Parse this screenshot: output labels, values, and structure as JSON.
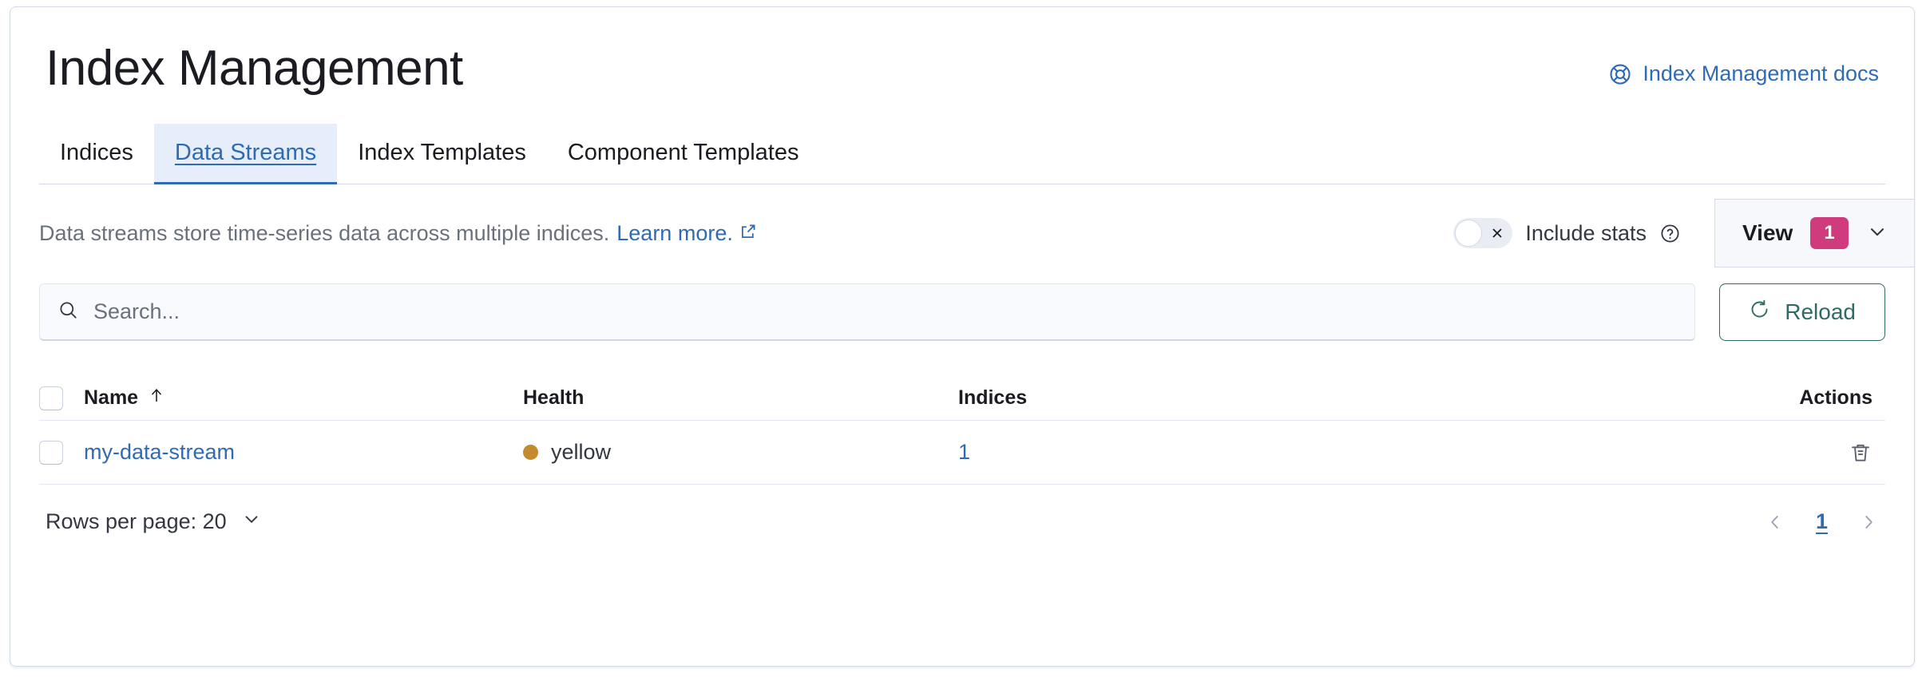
{
  "header": {
    "title": "Index Management",
    "docs_link": {
      "label": "Index Management docs",
      "icon": "help-lifebuoy-icon"
    }
  },
  "tabs": [
    {
      "label": "Indices",
      "active": false
    },
    {
      "label": "Data Streams",
      "active": true
    },
    {
      "label": "Index Templates",
      "active": false
    },
    {
      "label": "Component Templates",
      "active": false
    }
  ],
  "controls": {
    "description": "Data streams store time-series data across multiple indices.",
    "learn_more_label": "Learn more.",
    "learn_more_icon": "external-link-icon",
    "include_stats": {
      "label": "Include stats",
      "enabled": false,
      "off_icon": "cross-icon",
      "help_icon": "question-in-circle-icon"
    },
    "view_button": {
      "label": "View",
      "badge": "1",
      "chevron_icon": "chevron-down-icon"
    }
  },
  "search": {
    "value": "",
    "placeholder": "Search...",
    "icon": "search-icon"
  },
  "reload_button": {
    "label": "Reload",
    "icon": "refresh-icon"
  },
  "table": {
    "columns": {
      "name": "Name",
      "name_sort_icon": "sort-ascending-arrow-icon",
      "health": "Health",
      "indices": "Indices",
      "actions": "Actions"
    },
    "rows": [
      {
        "name": "my-data-stream",
        "health": "yellow",
        "health_color": "#c5892e",
        "indices": "1",
        "action_icon": "trash-icon"
      }
    ]
  },
  "footer": {
    "rows_per_page_label": "Rows per page: 20",
    "rows_per_page_chevron": "chevron-down-icon",
    "prev_icon": "chevron-left-icon",
    "page_number": "1",
    "next_icon": "chevron-right-icon"
  },
  "colors": {
    "link_blue": "#2f6bb5",
    "accent_pink": "#cf3b7c",
    "reload_teal": "#2e6b63",
    "health_yellow": "#c5892e",
    "tab_active_bg": "#e6eefb"
  }
}
